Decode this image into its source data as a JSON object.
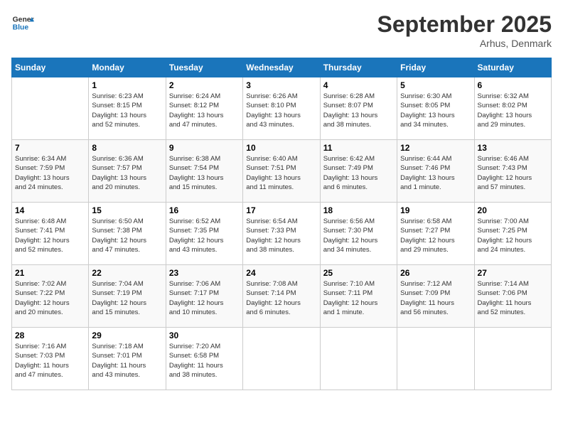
{
  "header": {
    "logo_line1": "General",
    "logo_line2": "Blue",
    "main_title": "September 2025",
    "subtitle": "Arhus, Denmark"
  },
  "days_of_week": [
    "Sunday",
    "Monday",
    "Tuesday",
    "Wednesday",
    "Thursday",
    "Friday",
    "Saturday"
  ],
  "weeks": [
    [
      {
        "day": "",
        "info": ""
      },
      {
        "day": "1",
        "info": "Sunrise: 6:23 AM\nSunset: 8:15 PM\nDaylight: 13 hours\nand 52 minutes."
      },
      {
        "day": "2",
        "info": "Sunrise: 6:24 AM\nSunset: 8:12 PM\nDaylight: 13 hours\nand 47 minutes."
      },
      {
        "day": "3",
        "info": "Sunrise: 6:26 AM\nSunset: 8:10 PM\nDaylight: 13 hours\nand 43 minutes."
      },
      {
        "day": "4",
        "info": "Sunrise: 6:28 AM\nSunset: 8:07 PM\nDaylight: 13 hours\nand 38 minutes."
      },
      {
        "day": "5",
        "info": "Sunrise: 6:30 AM\nSunset: 8:05 PM\nDaylight: 13 hours\nand 34 minutes."
      },
      {
        "day": "6",
        "info": "Sunrise: 6:32 AM\nSunset: 8:02 PM\nDaylight: 13 hours\nand 29 minutes."
      }
    ],
    [
      {
        "day": "7",
        "info": "Sunrise: 6:34 AM\nSunset: 7:59 PM\nDaylight: 13 hours\nand 24 minutes."
      },
      {
        "day": "8",
        "info": "Sunrise: 6:36 AM\nSunset: 7:57 PM\nDaylight: 13 hours\nand 20 minutes."
      },
      {
        "day": "9",
        "info": "Sunrise: 6:38 AM\nSunset: 7:54 PM\nDaylight: 13 hours\nand 15 minutes."
      },
      {
        "day": "10",
        "info": "Sunrise: 6:40 AM\nSunset: 7:51 PM\nDaylight: 13 hours\nand 11 minutes."
      },
      {
        "day": "11",
        "info": "Sunrise: 6:42 AM\nSunset: 7:49 PM\nDaylight: 13 hours\nand 6 minutes."
      },
      {
        "day": "12",
        "info": "Sunrise: 6:44 AM\nSunset: 7:46 PM\nDaylight: 13 hours\nand 1 minute."
      },
      {
        "day": "13",
        "info": "Sunrise: 6:46 AM\nSunset: 7:43 PM\nDaylight: 12 hours\nand 57 minutes."
      }
    ],
    [
      {
        "day": "14",
        "info": "Sunrise: 6:48 AM\nSunset: 7:41 PM\nDaylight: 12 hours\nand 52 minutes."
      },
      {
        "day": "15",
        "info": "Sunrise: 6:50 AM\nSunset: 7:38 PM\nDaylight: 12 hours\nand 47 minutes."
      },
      {
        "day": "16",
        "info": "Sunrise: 6:52 AM\nSunset: 7:35 PM\nDaylight: 12 hours\nand 43 minutes."
      },
      {
        "day": "17",
        "info": "Sunrise: 6:54 AM\nSunset: 7:33 PM\nDaylight: 12 hours\nand 38 minutes."
      },
      {
        "day": "18",
        "info": "Sunrise: 6:56 AM\nSunset: 7:30 PM\nDaylight: 12 hours\nand 34 minutes."
      },
      {
        "day": "19",
        "info": "Sunrise: 6:58 AM\nSunset: 7:27 PM\nDaylight: 12 hours\nand 29 minutes."
      },
      {
        "day": "20",
        "info": "Sunrise: 7:00 AM\nSunset: 7:25 PM\nDaylight: 12 hours\nand 24 minutes."
      }
    ],
    [
      {
        "day": "21",
        "info": "Sunrise: 7:02 AM\nSunset: 7:22 PM\nDaylight: 12 hours\nand 20 minutes."
      },
      {
        "day": "22",
        "info": "Sunrise: 7:04 AM\nSunset: 7:19 PM\nDaylight: 12 hours\nand 15 minutes."
      },
      {
        "day": "23",
        "info": "Sunrise: 7:06 AM\nSunset: 7:17 PM\nDaylight: 12 hours\nand 10 minutes."
      },
      {
        "day": "24",
        "info": "Sunrise: 7:08 AM\nSunset: 7:14 PM\nDaylight: 12 hours\nand 6 minutes."
      },
      {
        "day": "25",
        "info": "Sunrise: 7:10 AM\nSunset: 7:11 PM\nDaylight: 12 hours\nand 1 minute."
      },
      {
        "day": "26",
        "info": "Sunrise: 7:12 AM\nSunset: 7:09 PM\nDaylight: 11 hours\nand 56 minutes."
      },
      {
        "day": "27",
        "info": "Sunrise: 7:14 AM\nSunset: 7:06 PM\nDaylight: 11 hours\nand 52 minutes."
      }
    ],
    [
      {
        "day": "28",
        "info": "Sunrise: 7:16 AM\nSunset: 7:03 PM\nDaylight: 11 hours\nand 47 minutes."
      },
      {
        "day": "29",
        "info": "Sunrise: 7:18 AM\nSunset: 7:01 PM\nDaylight: 11 hours\nand 43 minutes."
      },
      {
        "day": "30",
        "info": "Sunrise: 7:20 AM\nSunset: 6:58 PM\nDaylight: 11 hours\nand 38 minutes."
      },
      {
        "day": "",
        "info": ""
      },
      {
        "day": "",
        "info": ""
      },
      {
        "day": "",
        "info": ""
      },
      {
        "day": "",
        "info": ""
      }
    ]
  ]
}
